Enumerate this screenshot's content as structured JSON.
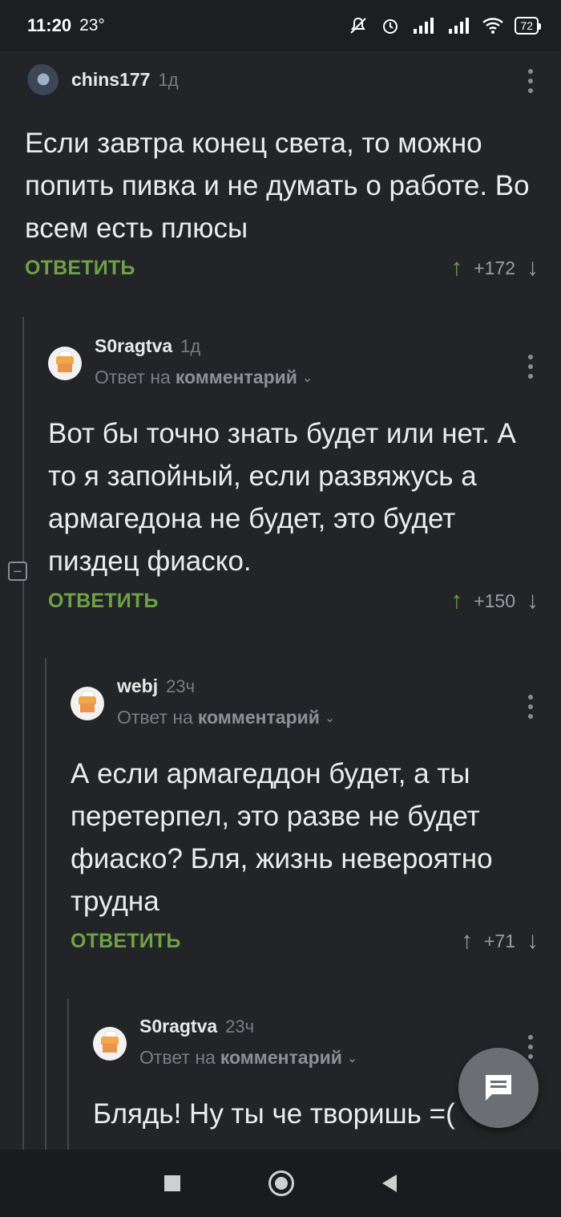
{
  "status_bar": {
    "time": "11:20",
    "temperature": "23°",
    "battery": "72"
  },
  "comments": [
    {
      "username": "chins177",
      "time": "1д",
      "reply_prefix": "",
      "reply_target": "",
      "text": "Если завтра конец света, то можно попить пивка и не думать о работе. Во всем есть плюсы",
      "reply_label": "ОТВЕТИТЬ",
      "rating": "+172",
      "avatar": "photo-avatar"
    },
    {
      "username": "S0ragtva",
      "time": "1д",
      "reply_prefix": "Ответ на",
      "reply_target": "комментарий",
      "text": "Вот бы точно знать будет или нет. А то я запойный, если развяжусь а армагедона не будет, это будет пиздец фиаско.",
      "reply_label": "ОТВЕТИТЬ",
      "rating": "+150",
      "avatar": "house-avatar"
    },
    {
      "username": "webj",
      "time": "23ч",
      "reply_prefix": "Ответ на",
      "reply_target": "комментарий",
      "text": "А если армагеддон будет, а ты перетерпел, это разве не будет фиаско? Бля, жизнь невероятно трудна",
      "reply_label": "ОТВЕТИТЬ",
      "rating": "+71",
      "avatar": "house-avatar"
    },
    {
      "username": "S0ragtva",
      "time": "23ч",
      "reply_prefix": "Ответ на",
      "reply_target": "комментарий",
      "text": "Блядь! Ну ты че творишь =(",
      "avatar": "house-avatar"
    }
  ],
  "icons": {
    "fab": "comment-icon",
    "vote_up": "arrow-up-icon",
    "vote_down": "arrow-down-icon"
  },
  "colors": {
    "background": "#222427",
    "accent": "#6fa246",
    "muted": "#7a7d82"
  }
}
